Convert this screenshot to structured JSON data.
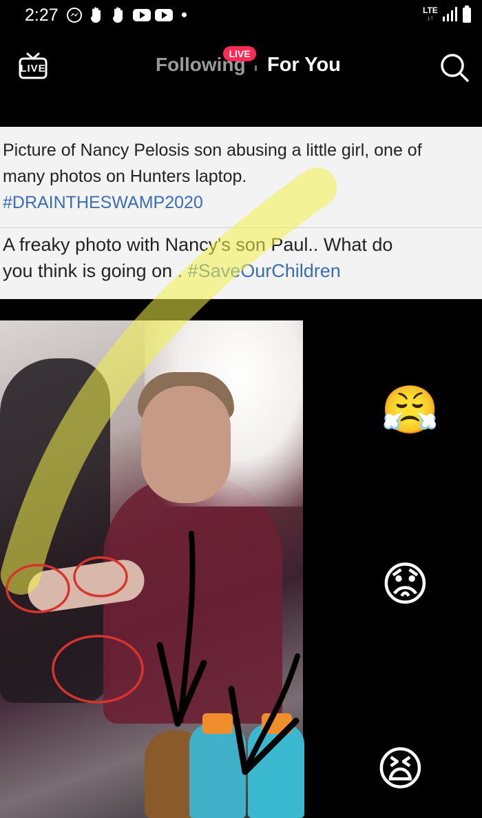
{
  "status_bar": {
    "time": "2:27",
    "network": "LTE",
    "network_sub": "↓↑"
  },
  "nav": {
    "live_label": "LIVE",
    "tabs": [
      {
        "label": "Following",
        "active": false
      },
      {
        "label": "For You",
        "active": true
      }
    ],
    "live_badge": "LIVE"
  },
  "post": {
    "line1": "Picture of Nancy Pelosis son abusing a little girl, one of",
    "line2": "many photos on Hunters laptop.",
    "hashtag1": "#DRAINTHESWAMP2020",
    "line3": "A freaky photo with Nancy's son Paul.. What do",
    "line4_text": "you think is going on . ",
    "hashtag2": "#SaveOurChildren"
  },
  "reactions": [
    {
      "emoji": "😤",
      "name": "steam-face"
    },
    {
      "emoji": "😟",
      "name": "worried-face"
    },
    {
      "emoji": "😫",
      "name": "tired-face"
    }
  ],
  "colors": {
    "live_pink": "#fe2c55",
    "hashtag_blue": "#3b6db4",
    "highlighter_yellow": "#f2f04a",
    "circle_red": "#d8342c"
  }
}
